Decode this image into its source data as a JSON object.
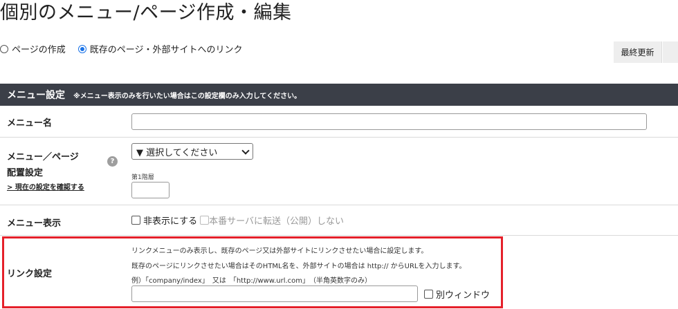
{
  "page": {
    "title": "個別のメニュー/ページ作成・編集"
  },
  "mode": {
    "options": [
      {
        "label": "ページの作成",
        "checked": false
      },
      {
        "label": "既存のページ・外部サイトへのリンク",
        "checked": true
      }
    ]
  },
  "tabs": {
    "last_updated": "最終更新"
  },
  "section": {
    "title": "メニュー設定",
    "note": "※メニュー表示のみを行いたい場合はこの設定欄のみ入力してください。"
  },
  "menu_name": {
    "label": "メニュー名",
    "value": ""
  },
  "placement": {
    "label_line1": "メニュー／ページ",
    "label_line2": "配置設定",
    "help_icon": "question-mark",
    "check_link": "> 現在の設定を確認する",
    "select_value": "▼ 選択してください",
    "level_label": "第1階層",
    "level_value": ""
  },
  "menu_display": {
    "label": "メニュー表示",
    "hide_label": "非表示にする",
    "hide_checked": false,
    "transfer_label": "本番サーバに転送（公開）しない",
    "transfer_checked": false
  },
  "link_settings": {
    "label": "リンク設定",
    "help1": "リンクメニューのみ表示し、既存のページ又は外部サイトにリンクさせたい場合に設定します。",
    "help2": "既存のページにリンクさせたい場合はそのHTML名を、外部サイトの場合は http:// からURLを入力します。",
    "example": "例）「company/index」　又は　「http://www.url.com」　（半角英数字のみ）",
    "url_value": "",
    "new_window_label": "別ウィンドウ",
    "new_window_checked": false
  },
  "colors": {
    "header_bg": "#3b3f48",
    "highlight": "#e5202a",
    "radio_accent": "#1a73e8"
  }
}
